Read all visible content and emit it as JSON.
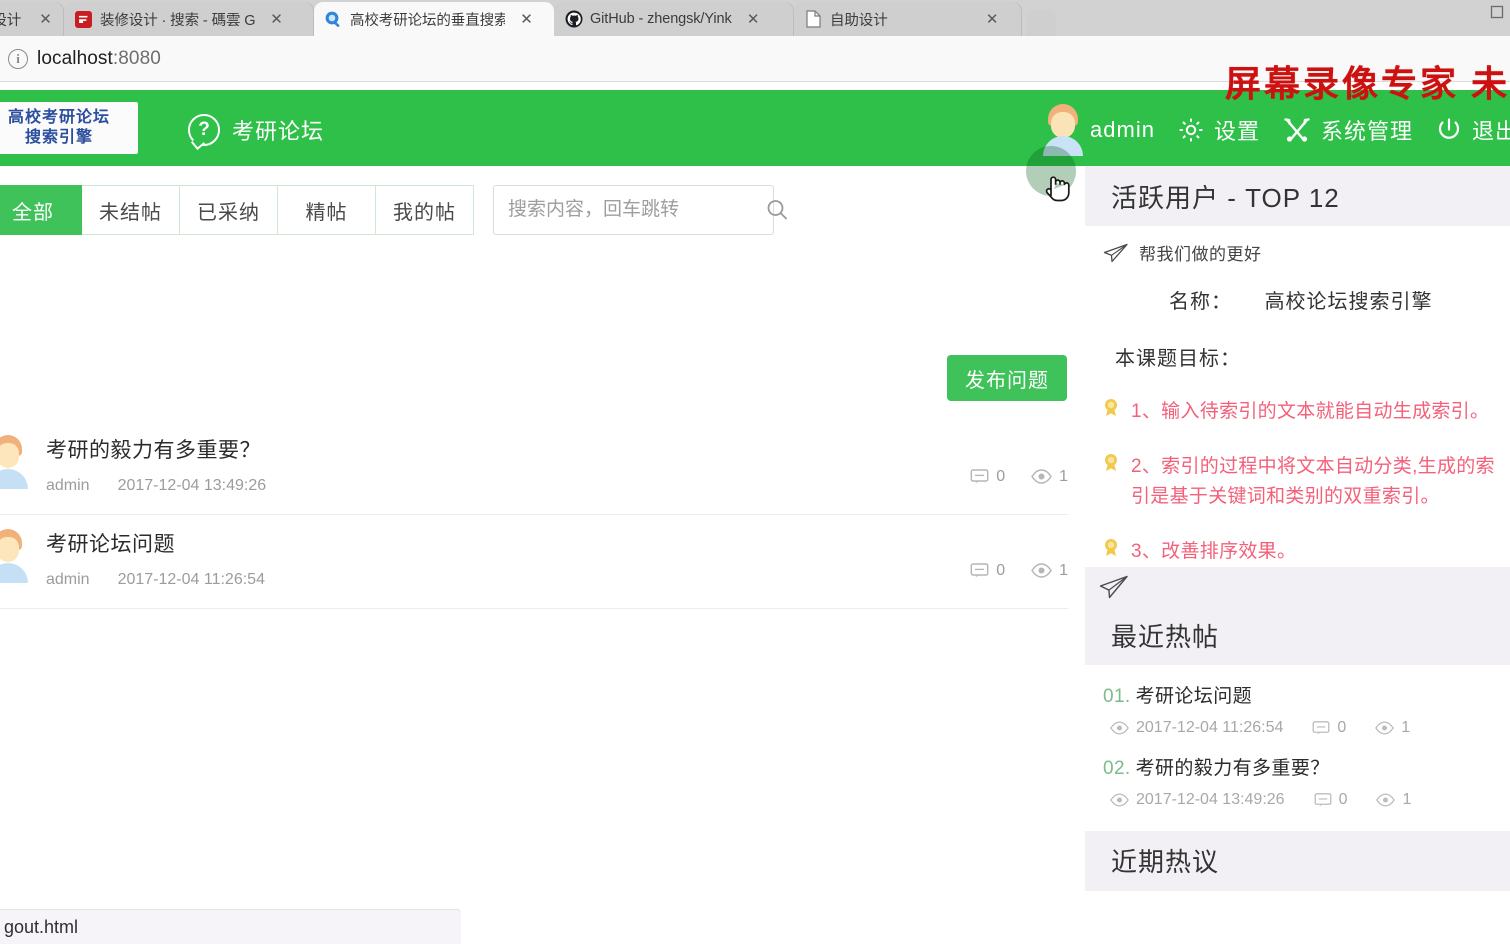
{
  "browser": {
    "tabs": [
      {
        "title": "线设计 · GitH",
        "favicon": "generic-icon",
        "active": false
      },
      {
        "title": "装修设计 · 搜索 - 碼雲 G",
        "favicon": "gitee-icon",
        "active": false
      },
      {
        "title": "高校考研论坛的垂直搜索",
        "favicon": "search-icon",
        "active": true
      },
      {
        "title": "GitHub - zhengsk/Yink",
        "favicon": "github-icon",
        "active": false
      },
      {
        "title": "自助设计",
        "favicon": "page-icon",
        "active": false
      }
    ],
    "close_label": "✕",
    "url": "localhost",
    "port": ":8080",
    "status_text": "gout.html"
  },
  "watermark": "屏幕录像专家 未",
  "header": {
    "logo_line1": "高校考研论坛",
    "logo_line2": "搜索引擎",
    "nav_forum": "考研论坛",
    "username": "admin",
    "settings": "设置",
    "system_manage": "系统管理",
    "logout": "退出",
    "bg_color": "#2fc04a"
  },
  "toolbar": {
    "filters": [
      {
        "label": "全部",
        "active": true
      },
      {
        "label": "未结帖",
        "active": false
      },
      {
        "label": "已采纳",
        "active": false
      },
      {
        "label": "精帖",
        "active": false
      },
      {
        "label": "我的帖",
        "active": false
      }
    ],
    "search_placeholder": "搜索内容，回车跳转",
    "search_value": "",
    "publish_label": "发布问题"
  },
  "posts": [
    {
      "title": "考研的毅力有多重要？",
      "author": "admin",
      "time": "2017-12-04 13:49:26",
      "comments": "0",
      "views": "1"
    },
    {
      "title": "考研论坛问题",
      "author": "admin",
      "time": "2017-12-04 11:26:54",
      "comments": "0",
      "views": "1"
    }
  ],
  "sidebar": {
    "active_users_title": "活跃用户 - TOP 12",
    "help_us_label": "帮我们做的更好",
    "name_label": "名称：",
    "name_value": "高校论坛搜索引擎",
    "goal_title": "本课题目标：",
    "goals": [
      "1、输入待索引的文本就能自动生成索引。",
      "2、索引的过程中将文本自动分类,生成的索引是基于关键词和类别的双重索引。",
      "3、改善排序效果。"
    ],
    "goal_color": "#f4607a",
    "hot_posts_title": "最近热帖",
    "hot_posts": [
      {
        "index": "01.",
        "title": "考研论坛问题",
        "time": "2017-12-04 11:26:54",
        "comments": "0",
        "views": "1"
      },
      {
        "index": "02.",
        "title": "考研的毅力有多重要？",
        "time": "2017-12-04 13:49:26",
        "comments": "0",
        "views": "1"
      }
    ],
    "recent_discussion_title": "近期热议"
  }
}
